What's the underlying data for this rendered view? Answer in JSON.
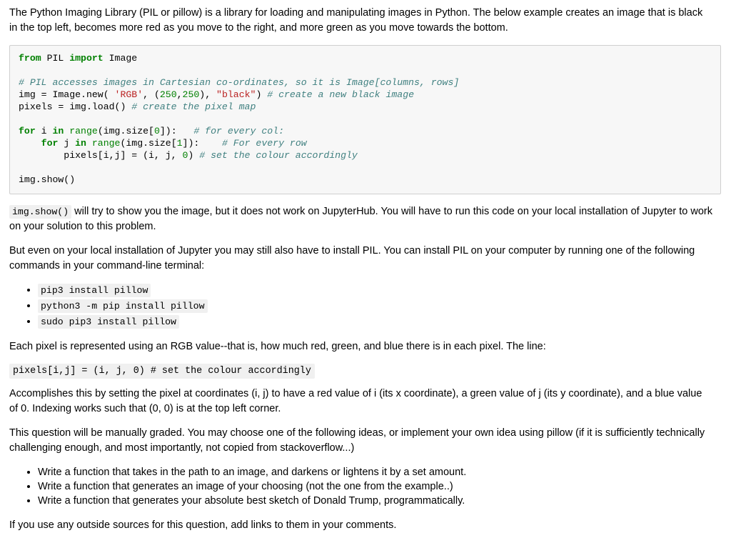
{
  "document": {
    "intro_paragraph": "The Python Imaging Library (PIL or pillow) is a library for loading and manipulating images in Python. The below example creates an image that is black in the top left, becomes more red as you move to the right, and more green as you move towards the bottom.",
    "code_cell": {
      "language": "python",
      "lines": [
        [
          {
            "t": "from ",
            "c": "k"
          },
          {
            "t": "PIL ",
            "c": "n"
          },
          {
            "t": "import ",
            "c": "k"
          },
          {
            "t": "Image",
            "c": "n"
          }
        ],
        [],
        [
          {
            "t": "# PIL accesses images in Cartesian co-ordinates, so it is Image[columns, rows]",
            "c": "c"
          }
        ],
        [
          {
            "t": "img = Image.new( ",
            "c": "n"
          },
          {
            "t": "'RGB'",
            "c": "s"
          },
          {
            "t": ", (",
            "c": "n"
          },
          {
            "t": "250",
            "c": "mi"
          },
          {
            "t": ",",
            "c": "n"
          },
          {
            "t": "250",
            "c": "mi"
          },
          {
            "t": "), ",
            "c": "n"
          },
          {
            "t": "\"black\"",
            "c": "s"
          },
          {
            "t": ") ",
            "c": "n"
          },
          {
            "t": "# create a new black image",
            "c": "c"
          }
        ],
        [
          {
            "t": "pixels = img.load() ",
            "c": "n"
          },
          {
            "t": "# create the pixel map",
            "c": "c"
          }
        ],
        [],
        [
          {
            "t": "for ",
            "c": "k"
          },
          {
            "t": "i ",
            "c": "n"
          },
          {
            "t": "in ",
            "c": "k"
          },
          {
            "t": "range",
            "c": "nb"
          },
          {
            "t": "(img.size[",
            "c": "n"
          },
          {
            "t": "0",
            "c": "mi"
          },
          {
            "t": "]):   ",
            "c": "n"
          },
          {
            "t": "# for every col:",
            "c": "c"
          }
        ],
        [
          {
            "t": "    ",
            "c": "n"
          },
          {
            "t": "for ",
            "c": "k"
          },
          {
            "t": "j ",
            "c": "n"
          },
          {
            "t": "in ",
            "c": "k"
          },
          {
            "t": "range",
            "c": "nb"
          },
          {
            "t": "(img.size[",
            "c": "n"
          },
          {
            "t": "1",
            "c": "mi"
          },
          {
            "t": "]):    ",
            "c": "n"
          },
          {
            "t": "# For every row",
            "c": "c"
          }
        ],
        [
          {
            "t": "        pixels[i,j] = (i, j, ",
            "c": "n"
          },
          {
            "t": "0",
            "c": "mi"
          },
          {
            "t": ") ",
            "c": "n"
          },
          {
            "t": "# set the colour accordingly",
            "c": "c"
          }
        ],
        [],
        [
          {
            "t": "img.show()",
            "c": "n"
          }
        ]
      ]
    },
    "show_paragraph": {
      "code": "img.show()",
      "text": " will try to show you the image, but it does not work on JupyterHub. You will have to run this code on your local installation of Jupyter to work on your solution to this problem."
    },
    "install_paragraph": "But even on your local installation of Jupyter you may still also have to install PIL. You can install PIL on your computer by running one of the following commands in your command-line terminal:",
    "install_commands": [
      "pip3 install pillow",
      "python3 -m pip install pillow",
      "sudo pip3 install pillow"
    ],
    "rgb_paragraph": "Each pixel is represented using an RGB value--that is, how much red, green, and blue there is in each pixel. The line:",
    "pixel_line_code": "pixels[i,j] = (i, j, 0) # set the colour accordingly",
    "accomplishes_paragraph": "Accomplishes this by setting the pixel at coordinates (i, j) to have a red value of i (its x coordinate), a green value of j (its y coordinate), and a blue value of 0. Indexing works such that (0, 0) is at the top left corner.",
    "grading_paragraph": "This question will be manually graded. You may choose one of the following ideas, or implement your own idea using pillow (if it is sufficiently technically challenging enough, and most importantly, not copied from stackoverflow...)",
    "ideas": [
      "Write a function that takes in the path to an image, and darkens or lightens it by a set amount.",
      "Write a function that generates an image of your choosing (not the one from the example..)",
      "Write a function that generates your absolute best sketch of Donald Trump, programmatically."
    ],
    "sources_paragraph": "If you use any outside sources for this question, add links to them in your comments."
  },
  "colors": {
    "code_background": "#f7f7f7",
    "code_border": "#cfcfcf",
    "inline_code_background": "#f0f0f0",
    "keyword": "#008000",
    "string": "#ba2121",
    "number": "#008000",
    "comment": "#408080",
    "text": "#000000"
  }
}
